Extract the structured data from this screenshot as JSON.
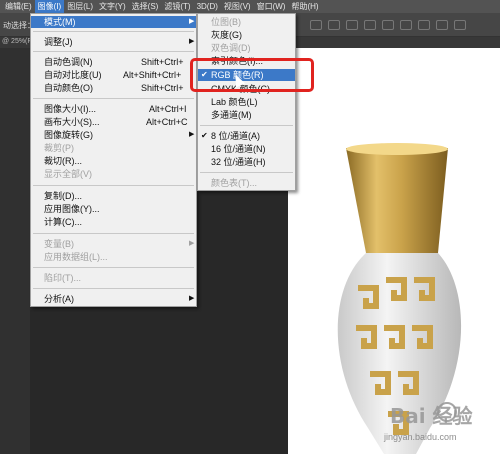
{
  "menubar": [
    "编辑(E)",
    "图像(I)",
    "图层(L)",
    "文字(Y)",
    "选择(S)",
    "滤镜(T)",
    "3D(D)",
    "视图(V)",
    "窗口(W)",
    "帮助(H)"
  ],
  "optionsbar": {
    "label": "动选择："
  },
  "doctab": {
    "title": "@ 25%(R"
  },
  "image_menu": [
    {
      "label": "模式(M)",
      "shortcut": "",
      "submenu": true,
      "highlighted": true
    },
    {
      "label": "调整(J)",
      "shortcut": "",
      "submenu": true
    },
    {
      "label": "自动色调(N)",
      "shortcut": "Shift+Ctrl+"
    },
    {
      "label": "自动对比度(U)",
      "shortcut": "Alt+Shift+Ctrl+"
    },
    {
      "label": "自动颜色(O)",
      "shortcut": "Shift+Ctrl+"
    },
    {
      "label": "图像大小(I)...",
      "shortcut": "Alt+Ctrl+I"
    },
    {
      "label": "画布大小(S)...",
      "shortcut": "Alt+Ctrl+C"
    },
    {
      "label": "图像旋转(G)",
      "shortcut": "",
      "submenu": true
    },
    {
      "label": "裁剪(P)",
      "shortcut": "",
      "disabled": true
    },
    {
      "label": "裁切(R)...",
      "shortcut": ""
    },
    {
      "label": "显示全部(V)",
      "shortcut": "",
      "disabled": true
    },
    {
      "label": "复制(D)...",
      "shortcut": ""
    },
    {
      "label": "应用图像(Y)...",
      "shortcut": ""
    },
    {
      "label": "计算(C)...",
      "shortcut": ""
    },
    {
      "label": "变量(B)",
      "shortcut": "",
      "submenu": true,
      "disabled": true
    },
    {
      "label": "应用数据组(L)...",
      "shortcut": "",
      "disabled": true
    },
    {
      "label": "陷印(T)...",
      "shortcut": "",
      "disabled": true
    },
    {
      "label": "分析(A)",
      "shortcut": "",
      "submenu": true
    }
  ],
  "mode_menu": [
    {
      "label": "位图(B)",
      "disabled": true
    },
    {
      "label": "灰度(G)"
    },
    {
      "label": "双色调(D)",
      "disabled": true
    },
    {
      "label": "索引颜色(I)..."
    },
    {
      "label": "RGB 颜色(R)",
      "checked": true,
      "highlighted": true
    },
    {
      "label": "CMYK 颜色(C)"
    },
    {
      "label": "Lab 颜色(L)"
    },
    {
      "label": "多通道(M)"
    },
    {
      "label": "8 位/通道(A)",
      "checked": true
    },
    {
      "label": "16 位/通道(N)"
    },
    {
      "label": "32 位/通道(H)"
    },
    {
      "label": "颜色表(T)...",
      "disabled": true
    }
  ],
  "watermark": {
    "logo": "Bai 经验",
    "url": "jingyan.baidu.com"
  },
  "colors": {
    "menubar": "#535353",
    "highlight": "#3c79c8",
    "annotation": "#e0231f",
    "gold": "#c9a24a"
  }
}
